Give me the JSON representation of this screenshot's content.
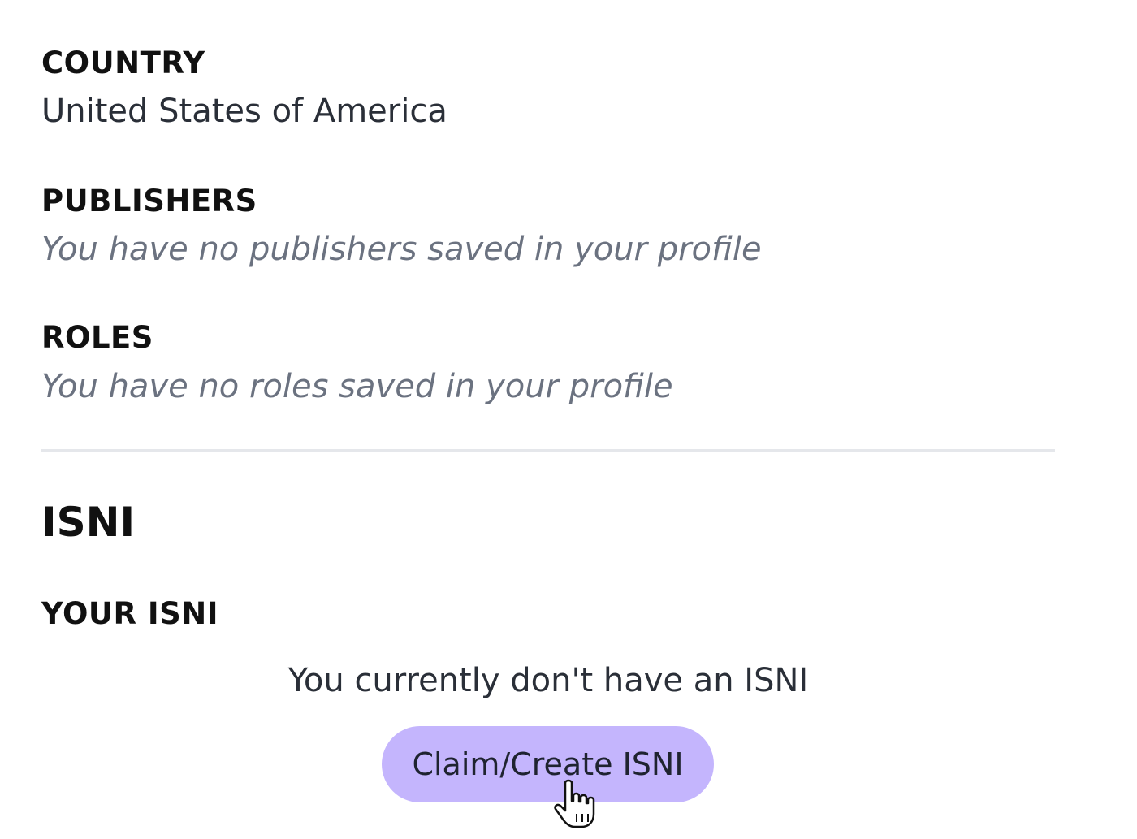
{
  "country": {
    "label": "COUNTRY",
    "value": "United States of America"
  },
  "publishers": {
    "label": "PUBLISHERS",
    "empty_text": "You have no publishers saved in your profile"
  },
  "roles": {
    "label": "ROLES",
    "empty_text": "You have no roles saved in your profile"
  },
  "isni": {
    "heading": "ISNI",
    "your_isni_label": "YOUR ISNI",
    "empty_message": "You currently don't have an ISNI",
    "button_label": "Claim/Create ISNI",
    "button_color": "#c4b5fd"
  },
  "cursor_icon": "hand-pointer-icon"
}
